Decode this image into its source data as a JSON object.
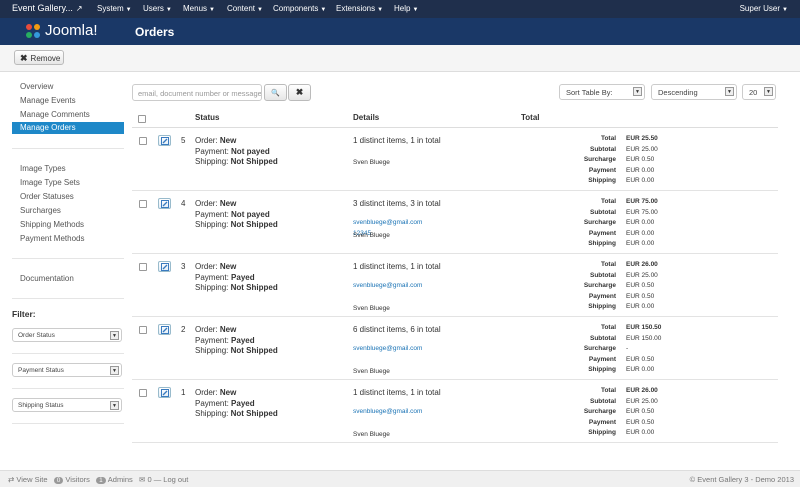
{
  "topnav": {
    "brand": "Event Gallery...",
    "brand_ext": "↗",
    "menus": [
      "System",
      "Users",
      "Menus",
      "Content",
      "Components",
      "Extensions",
      "Help"
    ],
    "caret": "▼",
    "user": "Super User"
  },
  "header": {
    "logo": "Joomla!",
    "title": "Orders"
  },
  "toolbar": {
    "remove_icon": "✖",
    "remove_label": "Remove"
  },
  "sidebar": {
    "group1": [
      "Overview",
      "Manage Events",
      "Manage Comments",
      "Manage Orders"
    ],
    "group2": [
      "Image Types",
      "Image Type Sets",
      "Order Statuses",
      "Surcharges",
      "Shipping Methods",
      "Payment Methods"
    ],
    "group3": [
      "Documentation"
    ],
    "filter_title": "Filter:",
    "filters": [
      "Order Status",
      "Payment Status",
      "Shipping Status"
    ]
  },
  "search": {
    "placeholder": "email, document number or message",
    "search_icon": "🔍",
    "clear_icon": "✖"
  },
  "sort": {
    "sort_by": "Sort Table By:",
    "direction": "Descending",
    "limit": "20",
    "arrow": "▼"
  },
  "table": {
    "headers": {
      "status": "Status",
      "details": "Details",
      "total": "Total"
    },
    "labels": {
      "order": "Order:",
      "payment": "Payment:",
      "shipping": "Shipping:"
    },
    "total_labels": [
      "Total",
      "Subtotal",
      "Surcharge",
      "Payment",
      "Shipping"
    ],
    "rows": [
      {
        "num": "5",
        "order": "New",
        "payment": "Not payed",
        "shipping": "Not Shipped",
        "items": "1 distinct items, 1 in total",
        "email": "",
        "doc": "",
        "customer": "Sven Bluege",
        "totals": [
          "EUR 25.50",
          "EUR 25.00",
          "EUR 0.50",
          "EUR 0.00",
          "EUR 0.00"
        ]
      },
      {
        "num": "4",
        "order": "New",
        "payment": "Not payed",
        "shipping": "Not Shipped",
        "items": "3 distinct items, 3 in total",
        "email": "svenbluege@gmail.com",
        "doc": "12345",
        "customer": "Sven Bluege",
        "totals": [
          "EUR 75.00",
          "EUR 75.00",
          "EUR 0.00",
          "EUR 0.00",
          "EUR 0.00"
        ]
      },
      {
        "num": "3",
        "order": "New",
        "payment": "Payed",
        "shipping": "Not Shipped",
        "items": "1 distinct items, 1 in total",
        "email": "svenbluege@gmail.com",
        "doc": "",
        "customer": "Sven Bluege",
        "totals": [
          "EUR 26.00",
          "EUR 25.00",
          "EUR 0.50",
          "EUR 0.50",
          "EUR 0.00"
        ]
      },
      {
        "num": "2",
        "order": "New",
        "payment": "Payed",
        "shipping": "Not Shipped",
        "items": "6 distinct items, 6 in total",
        "email": "svenbluege@gmail.com",
        "doc": "",
        "customer": "Sven Bluege",
        "totals": [
          "EUR 150.50",
          "EUR 150.00",
          "-",
          "EUR 0.50",
          "EUR 0.00"
        ]
      },
      {
        "num": "1",
        "order": "New",
        "payment": "Payed",
        "shipping": "Not Shipped",
        "items": "1 distinct items, 1 in total",
        "email": "svenbluege@gmail.com",
        "doc": "",
        "customer": "Sven Bluege",
        "totals": [
          "EUR 26.00",
          "EUR 25.00",
          "EUR 0.50",
          "EUR 0.50",
          "EUR 0.00"
        ]
      }
    ]
  },
  "footer": {
    "view_site_icon": "⇄",
    "view_site": "View Site",
    "visitors_count": "0",
    "visitors": "Visitors",
    "admins_count": "1",
    "admins": "Admins",
    "messages_icon": "✉",
    "messages_count": "0",
    "logout_icon": "—",
    "logout": "Log out",
    "copyright": "© Event Gallery 3 - Demo 2013"
  }
}
